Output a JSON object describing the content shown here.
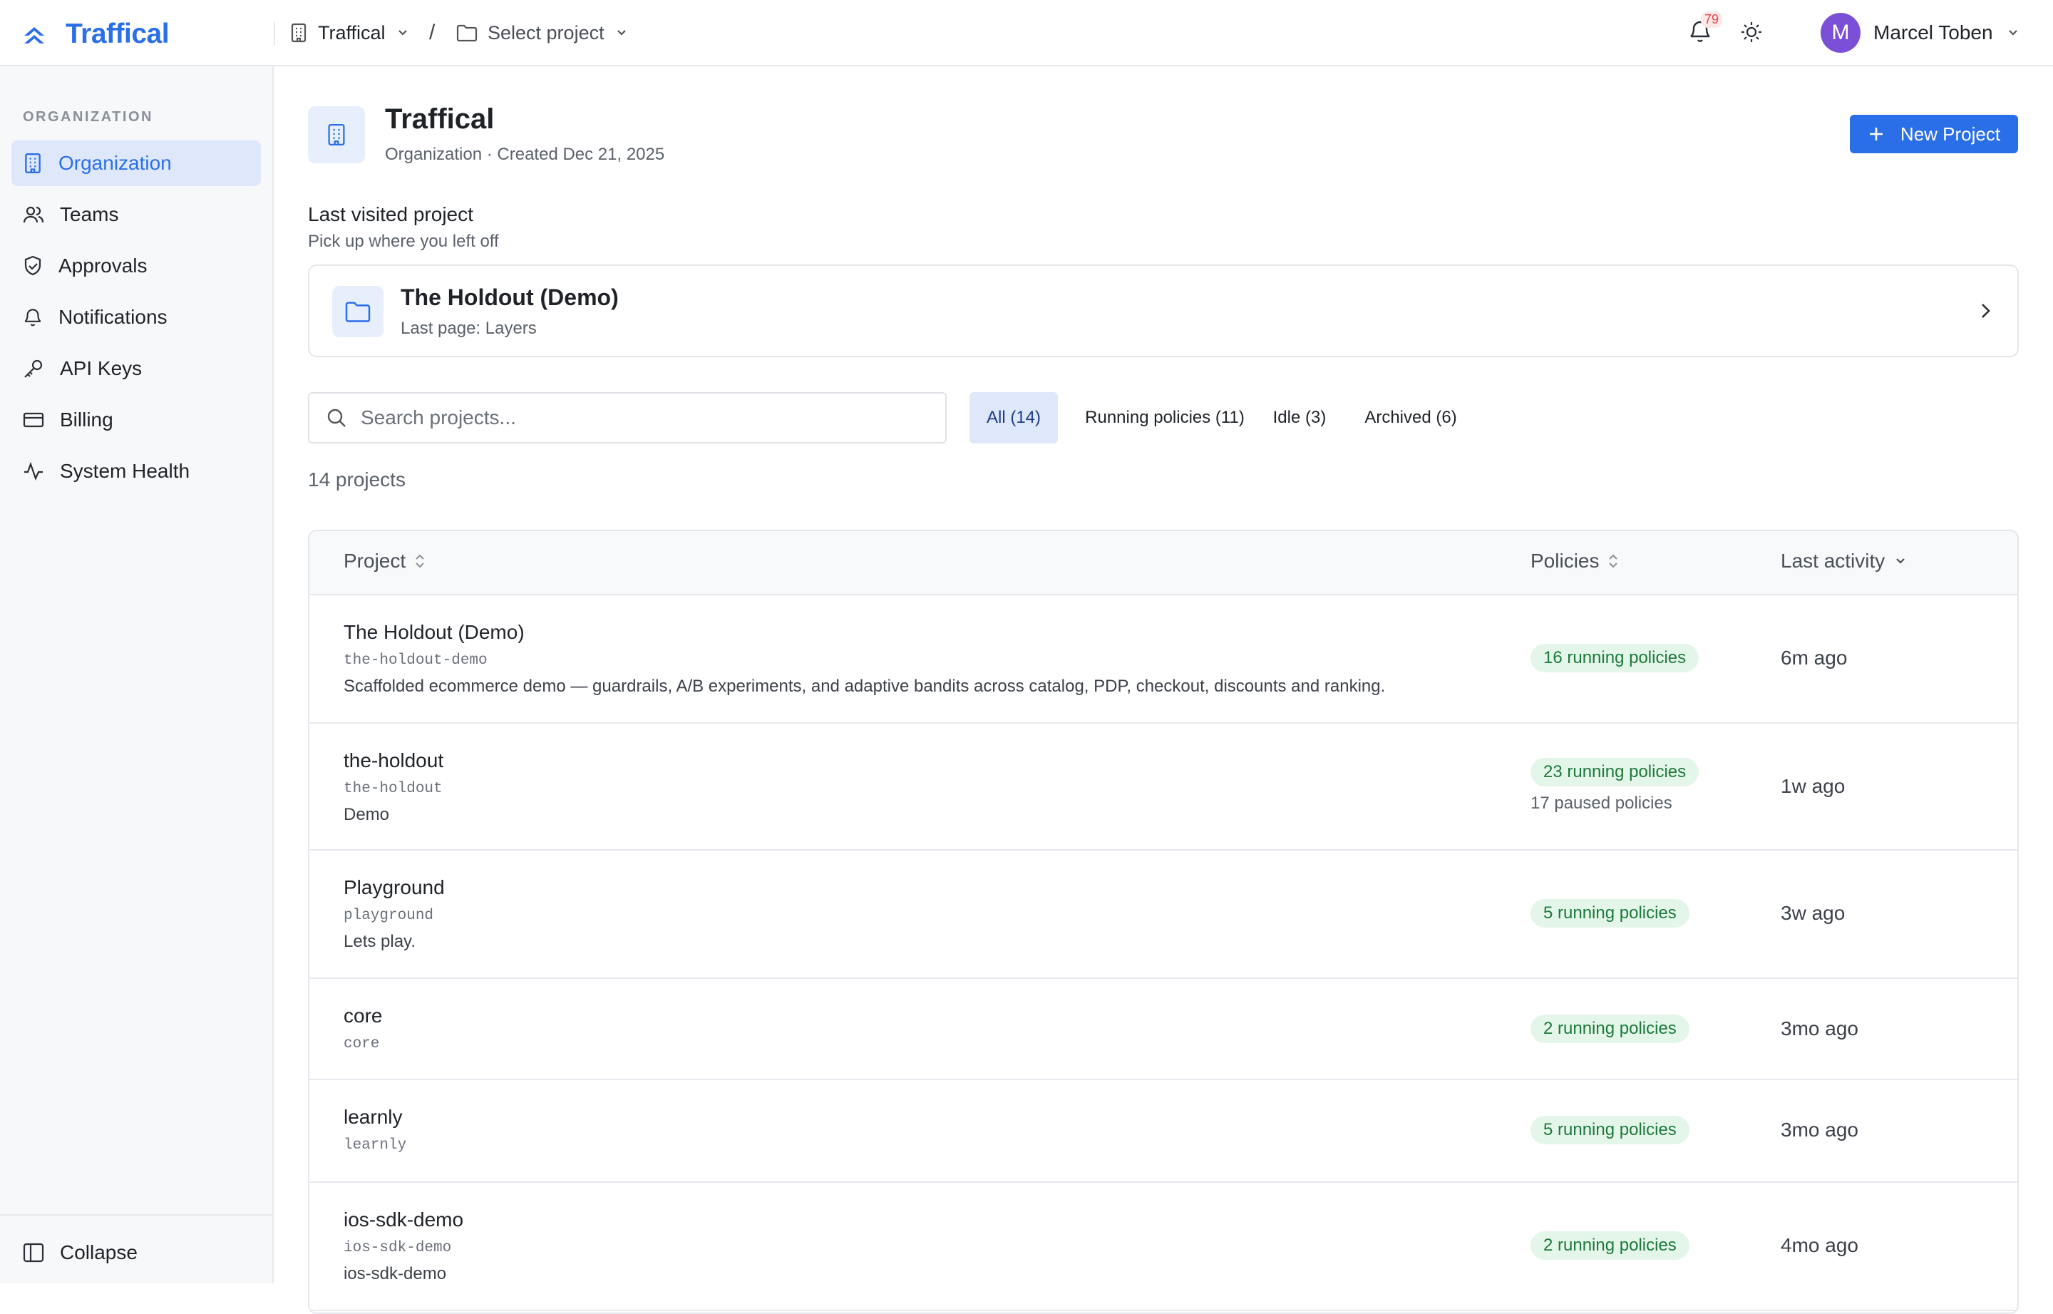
{
  "brand": {
    "name": "Traffical",
    "accent": "#2b6fe8"
  },
  "topbar": {
    "org_label": "Traffical",
    "separator": "/",
    "project_label": "Select project",
    "notification_count": "79",
    "user_initial": "M",
    "user_name": "Marcel Toben"
  },
  "sidebar": {
    "section_label": "ORGANIZATION",
    "items": [
      {
        "label": "Organization",
        "icon": "building-icon"
      },
      {
        "label": "Teams",
        "icon": "users-icon"
      },
      {
        "label": "Approvals",
        "icon": "shield-check-icon"
      },
      {
        "label": "Notifications",
        "icon": "bell-icon"
      },
      {
        "label": "API Keys",
        "icon": "key-icon"
      },
      {
        "label": "Billing",
        "icon": "credit-card-icon"
      },
      {
        "label": "System Health",
        "icon": "activity-icon"
      }
    ],
    "collapse_label": "Collapse"
  },
  "header": {
    "title": "Traffical",
    "subtitle": "Organization · Created Dec 21, 2025",
    "new_project_label": "New Project"
  },
  "last_visited": {
    "title": "Last visited project",
    "subtitle": "Pick up where you left off",
    "project_name": "The Holdout (Demo)",
    "last_page": "Last page: Layers"
  },
  "search": {
    "placeholder": "Search projects..."
  },
  "filters": [
    {
      "label": "All (14)",
      "active": true
    },
    {
      "label": "Running policies (11)",
      "active": false
    },
    {
      "label": "Idle (3)",
      "active": false
    },
    {
      "label": "Archived (6)",
      "active": false
    }
  ],
  "project_count": "14 projects",
  "table": {
    "columns": [
      "Project",
      "Policies",
      "Last activity"
    ],
    "rows": [
      {
        "name": "The Holdout (Demo)",
        "slug": "the-holdout-demo",
        "description": "Scaffolded ecommerce demo — guardrails, A/B experiments, and adaptive bandits across catalog, PDP, checkout, discounts and ranking.",
        "running": "16 running policies",
        "paused": "",
        "activity": "6m ago"
      },
      {
        "name": "the-holdout",
        "slug": "the-holdout",
        "description": "Demo",
        "running": "23 running policies",
        "paused": "17 paused policies",
        "activity": "1w ago"
      },
      {
        "name": "Playground",
        "slug": "playground",
        "description": "Lets play.",
        "running": "5 running policies",
        "paused": "",
        "activity": "3w ago"
      },
      {
        "name": "core",
        "slug": "core",
        "description": "",
        "running": "2 running policies",
        "paused": "",
        "activity": "3mo ago"
      },
      {
        "name": "learnly",
        "slug": "learnly",
        "description": "",
        "running": "5 running policies",
        "paused": "",
        "activity": "3mo ago"
      },
      {
        "name": "ios-sdk-demo",
        "slug": "ios-sdk-demo",
        "description": "ios-sdk-demo",
        "running": "2 running policies",
        "paused": "",
        "activity": "4mo ago"
      }
    ]
  }
}
